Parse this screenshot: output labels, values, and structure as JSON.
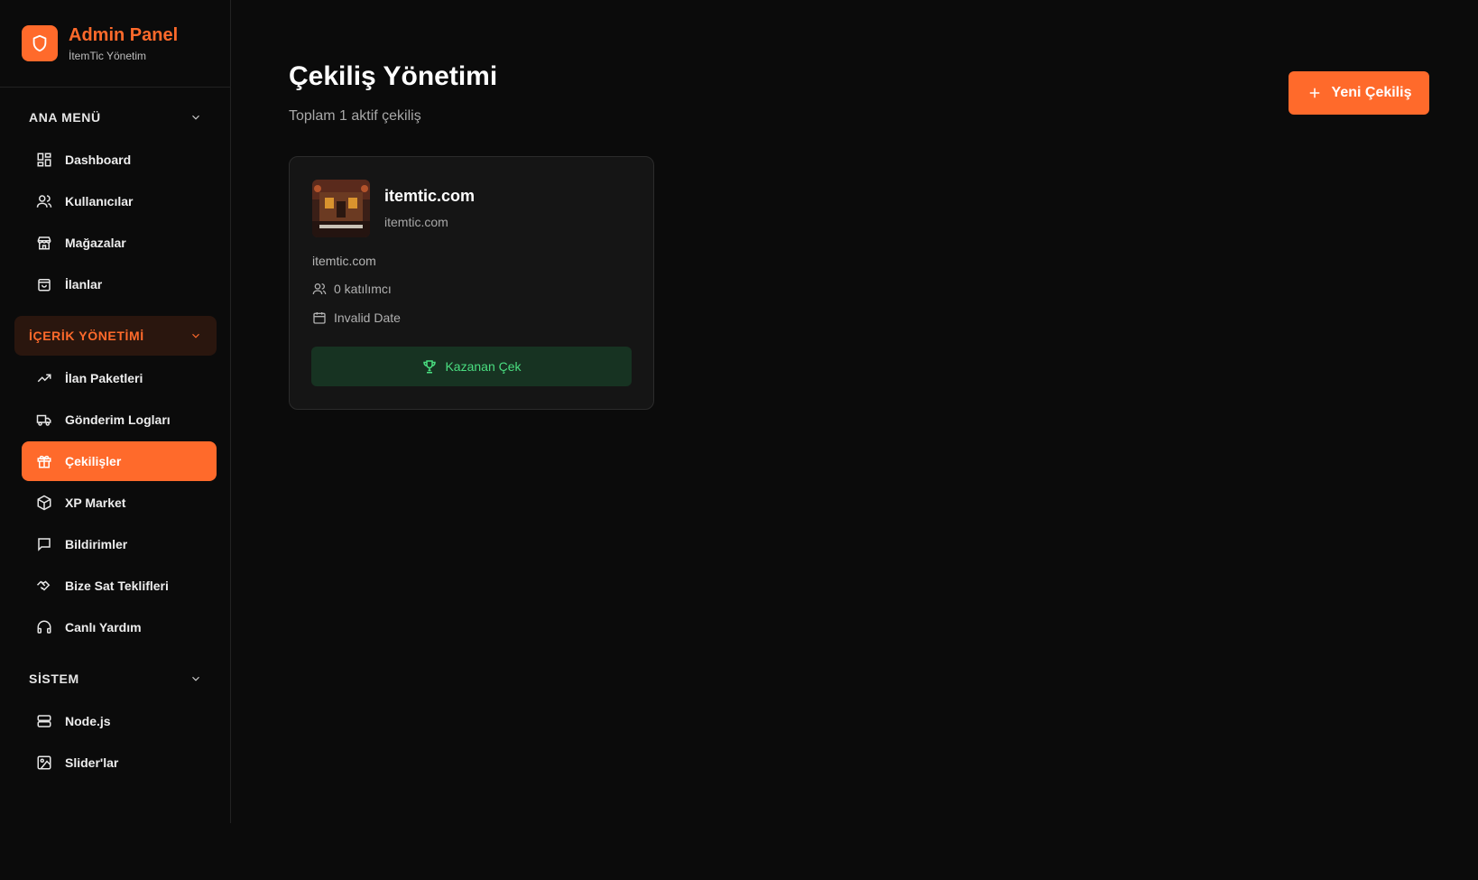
{
  "brand": {
    "title": "Admin Panel",
    "subtitle": "İtemTic Yönetim"
  },
  "sidebar": {
    "groups": [
      {
        "label": "ANA MENÜ",
        "items": [
          {
            "label": "Dashboard",
            "icon": "dashboard-icon"
          },
          {
            "label": "Kullanıcılar",
            "icon": "users-icon"
          },
          {
            "label": "Mağazalar",
            "icon": "store-icon"
          },
          {
            "label": "İlanlar",
            "icon": "shopping-bag-icon"
          }
        ]
      },
      {
        "label": "İÇERİK YÖNETİMİ",
        "items": [
          {
            "label": "İlan Paketleri",
            "icon": "trending-up-icon"
          },
          {
            "label": "Gönderim Logları",
            "icon": "truck-icon"
          },
          {
            "label": "Çekilişler",
            "icon": "gift-icon"
          },
          {
            "label": "XP Market",
            "icon": "package-icon"
          },
          {
            "label": "Bildirimler",
            "icon": "message-square-icon"
          },
          {
            "label": "Bize Sat Teklifleri",
            "icon": "handshake-icon"
          },
          {
            "label": "Canlı Yardım",
            "icon": "headphones-icon"
          }
        ]
      },
      {
        "label": "SİSTEM",
        "items": [
          {
            "label": "Node.js",
            "icon": "server-icon"
          },
          {
            "label": "Slider'lar",
            "icon": "image-icon"
          }
        ]
      }
    ],
    "active_item": "Çekilişler",
    "active_group": "İÇERİK YÖNETİMİ"
  },
  "page": {
    "title": "Çekiliş Yönetimi",
    "subtitle": "Toplam 1 aktif çekiliş",
    "new_button": "Yeni Çekiliş"
  },
  "giveaways": [
    {
      "title": "itemtic.com",
      "host": "itemtic.com",
      "description": "itemtic.com",
      "participants": "0 katılımcı",
      "date": "Invalid Date",
      "action": "Kazanan Çek"
    }
  ],
  "colors": {
    "accent": "#ff6a2b",
    "background": "#0b0b0b",
    "card": "#151515",
    "success": "#4ade80",
    "success_bg": "#173322"
  }
}
